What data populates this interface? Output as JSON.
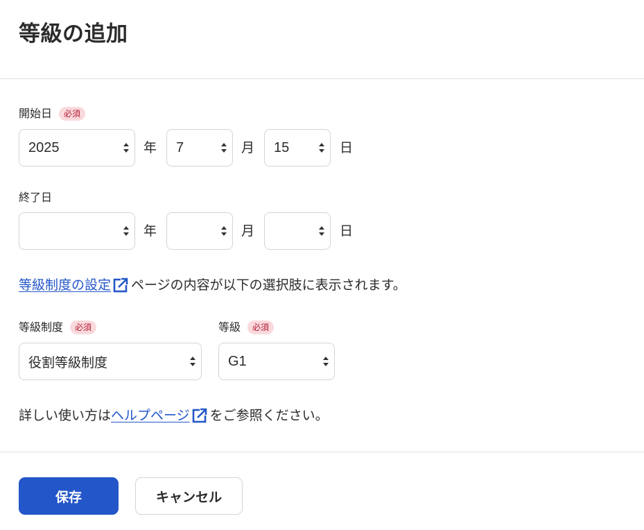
{
  "page": {
    "title": "等級の追加"
  },
  "start_date": {
    "label": "開始日",
    "required_badge": "必須",
    "year": {
      "value": "2025",
      "unit": "年"
    },
    "month": {
      "value": "7",
      "unit": "月"
    },
    "day": {
      "value": "15",
      "unit": "日"
    }
  },
  "end_date": {
    "label": "終了日",
    "year": {
      "value": "",
      "unit": "年"
    },
    "month": {
      "value": "",
      "unit": "月"
    },
    "day": {
      "value": "",
      "unit": "日"
    }
  },
  "grade_notice": {
    "link_text": "等級制度の設定",
    "text": "ページの内容が以下の選択肢に表示されます。"
  },
  "grade_system": {
    "label": "等級制度",
    "required_badge": "必須",
    "value": "役割等級制度"
  },
  "grade": {
    "label": "等級",
    "required_badge": "必須",
    "value": "G1"
  },
  "help": {
    "prefix": "詳しい使い方は",
    "link_text": "ヘルプページ",
    "suffix": "をご参照ください。"
  },
  "actions": {
    "save": "保存",
    "cancel": "キャンセル"
  },
  "colors": {
    "primary": "#2356c8",
    "badge_bg": "#fad9dd",
    "badge_text": "#b01d32",
    "link": "#2356c8"
  },
  "icons": {
    "external_link": "external-link-icon",
    "select_arrows": "select-arrows-icon"
  }
}
